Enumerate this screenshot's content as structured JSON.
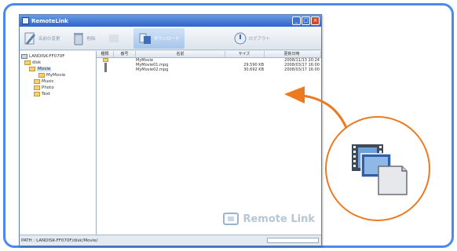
{
  "window": {
    "title": "RemoteLink"
  },
  "toolbar": {
    "items": [
      {
        "label": "名前の変更",
        "icon": "rename-icon"
      },
      {
        "label": "削除",
        "icon": "trash-icon"
      },
      {
        "label": "",
        "icon": "disabled-icon"
      },
      {
        "label": "ダウンロード",
        "icon": "download-icon"
      },
      {
        "label": "ログアウト",
        "icon": "logout-icon"
      }
    ]
  },
  "tree": {
    "root": "LANDISK-FF070F",
    "disk": "disk",
    "movie": "Movie",
    "mymovie": "MyMovie",
    "music": "Music",
    "photo": "Photo",
    "text": "Text"
  },
  "list": {
    "headers": [
      "種類",
      "番号",
      "名前",
      "サイズ",
      "更新日時"
    ],
    "rows": [
      {
        "type": "folder",
        "name": "MyMovie",
        "size": "",
        "date": "2008/11/13 20:24"
      },
      {
        "type": "movie",
        "name": "MyMovie01.mpg",
        "size": "29,590 KB",
        "date": "2008/03/17 16:00"
      },
      {
        "type": "movie",
        "name": "MyMovie02.mpg",
        "size": "30,692 KB",
        "date": "2008/03/17 16:00"
      }
    ]
  },
  "watermark": {
    "text": "Remote Link"
  },
  "status": {
    "path": "PATH : LANDISK-FF070F/disk/Movie/"
  },
  "colors": {
    "frame": "#4a8af0",
    "callout": "#ee7a20"
  }
}
